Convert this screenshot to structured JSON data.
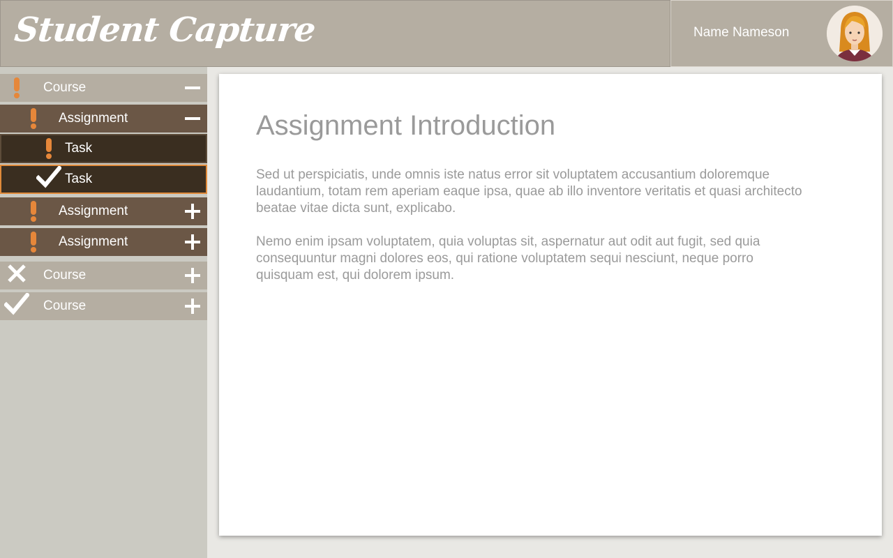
{
  "app": {
    "brand": "Student Capture",
    "user_name": "Name Nameson"
  },
  "colors": {
    "accent": "#e6873a",
    "header": "#b5aea2",
    "assignment_row": "#6b5746",
    "task_row": "#3a2e20"
  },
  "sidebar": {
    "items": [
      {
        "level": "course",
        "label": "Course",
        "status": "exclamation-icon",
        "toggle": "minus-icon"
      },
      {
        "level": "assignment",
        "label": "Assignment",
        "status": "exclamation-icon",
        "toggle": "minus-icon"
      },
      {
        "level": "task",
        "label": "Task",
        "status": "exclamation-icon",
        "toggle": ""
      },
      {
        "level": "task",
        "label": "Task",
        "status": "check-icon",
        "toggle": "",
        "selected": true
      },
      {
        "level": "assignment",
        "label": "Assignment",
        "status": "exclamation-icon",
        "toggle": "plus-icon"
      },
      {
        "level": "assignment",
        "label": "Assignment",
        "status": "exclamation-icon",
        "toggle": "plus-icon"
      },
      {
        "level": "course",
        "label": "Course",
        "status": "x-icon",
        "toggle": "plus-icon"
      },
      {
        "level": "course",
        "label": "Course",
        "status": "check-icon",
        "toggle": "plus-icon"
      }
    ]
  },
  "main": {
    "title": "Assignment Introduction",
    "paragraphs": [
      "Sed ut perspiciatis, unde omnis iste natus error sit voluptatem accusantium doloremque laudantium, totam rem aperiam eaque ipsa, quae ab illo inventore veritatis et quasi architecto beatae vitae dicta sunt, explicabo.",
      "Nemo enim ipsam voluptatem, quia voluptas sit, aspernatur aut odit aut fugit, sed quia consequuntur magni dolores eos, qui ratione voluptatem sequi nesciunt, neque porro quisquam est, qui dolorem ipsum."
    ]
  }
}
